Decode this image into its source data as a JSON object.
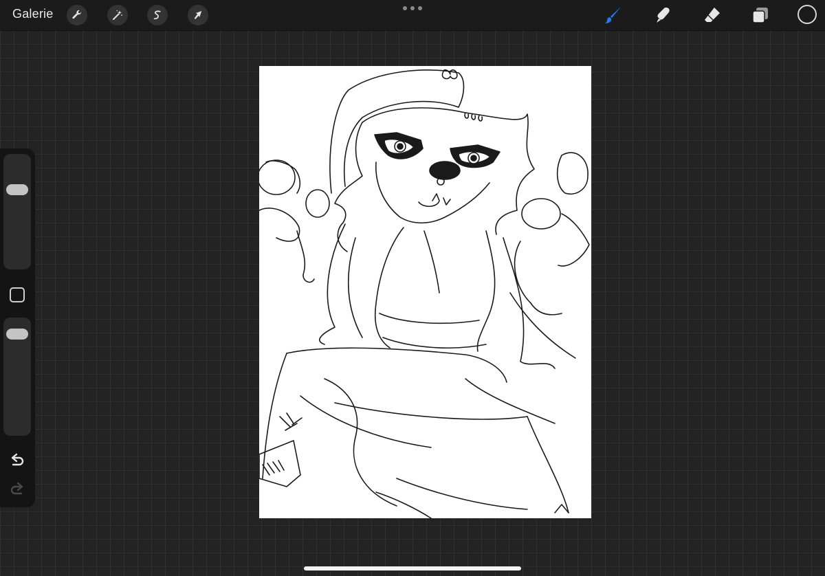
{
  "topbar": {
    "gallery_label": "Galerie",
    "left_tools": [
      {
        "icon": "wrench-icon",
        "name": "actions"
      },
      {
        "icon": "magic-wand-icon",
        "name": "adjustments"
      },
      {
        "icon": "s-selection-icon",
        "name": "selection"
      },
      {
        "icon": "arrow-cursor-icon",
        "name": "transform"
      }
    ],
    "right_tools": [
      {
        "icon": "brush-icon",
        "name": "paint",
        "active": true
      },
      {
        "icon": "smudge-icon",
        "name": "smudge"
      },
      {
        "icon": "eraser-icon",
        "name": "erase"
      },
      {
        "icon": "layers-icon",
        "name": "layers"
      }
    ],
    "current_color": "#1a1a1a",
    "accent_color": "#1e7bf0"
  },
  "sidebar": {
    "brush_size_level": 0.72,
    "opacity_level": 0.92,
    "modify_icon": "square-icon",
    "undo_icon": "undo-icon",
    "redo_icon": "redo-icon",
    "redo_enabled": false
  },
  "canvas": {
    "background": "#ffffff",
    "content": "line-art-sketch"
  }
}
